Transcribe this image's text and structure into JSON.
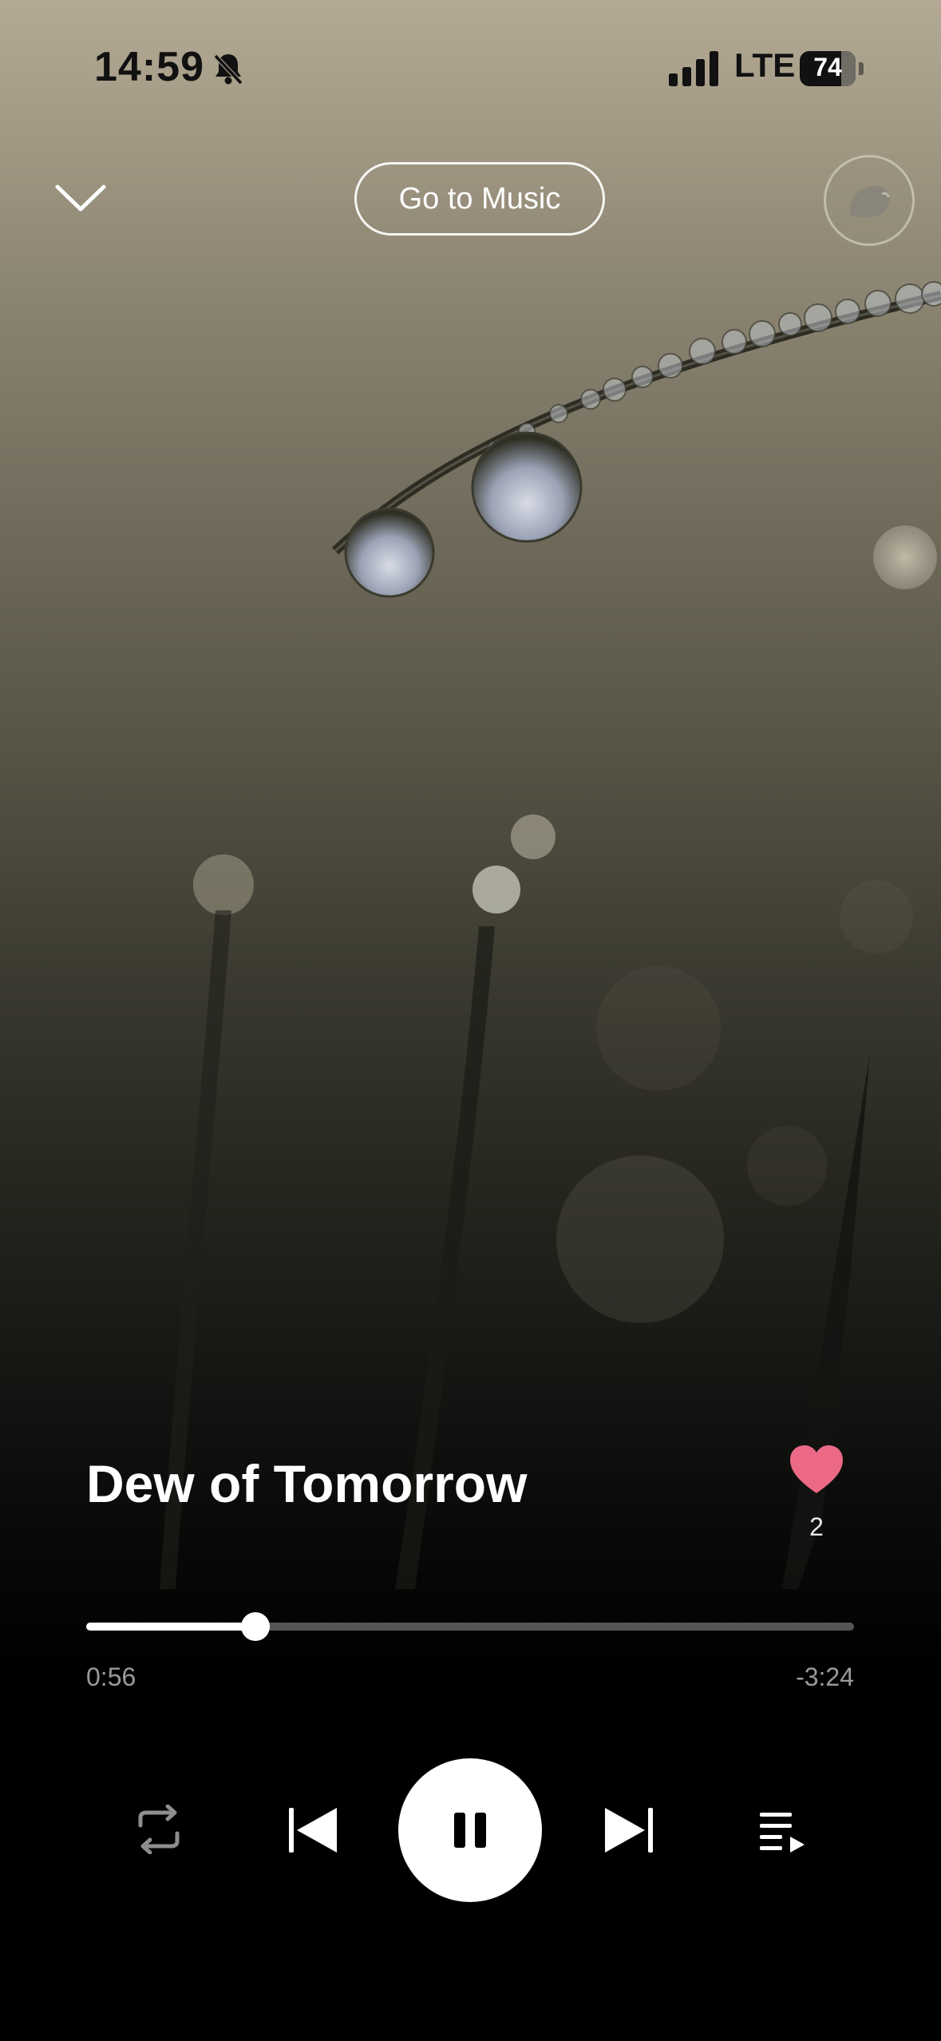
{
  "status_bar": {
    "time": "14:59",
    "network": "LTE",
    "battery": "74",
    "battery_level": 0.74,
    "icons": [
      "bell-slash-icon",
      "signal-bars-icon",
      "battery-icon"
    ]
  },
  "header": {
    "go_to_music_label": "Go to Music",
    "icons": [
      "chevron-down-icon",
      "avatar"
    ]
  },
  "track": {
    "title": "Dew of Tomorrow",
    "likes": "2",
    "liked": true,
    "elapsed": "0:56",
    "remaining": "-3:24",
    "progress": 0.22
  },
  "controls": {
    "icons": [
      "repeat-icon",
      "previous-icon",
      "pause-icon",
      "next-icon",
      "queue-icon"
    ]
  },
  "colors": {
    "heart": "#ec6a86",
    "accent": "#ffffff",
    "track_bg": "#555555"
  }
}
